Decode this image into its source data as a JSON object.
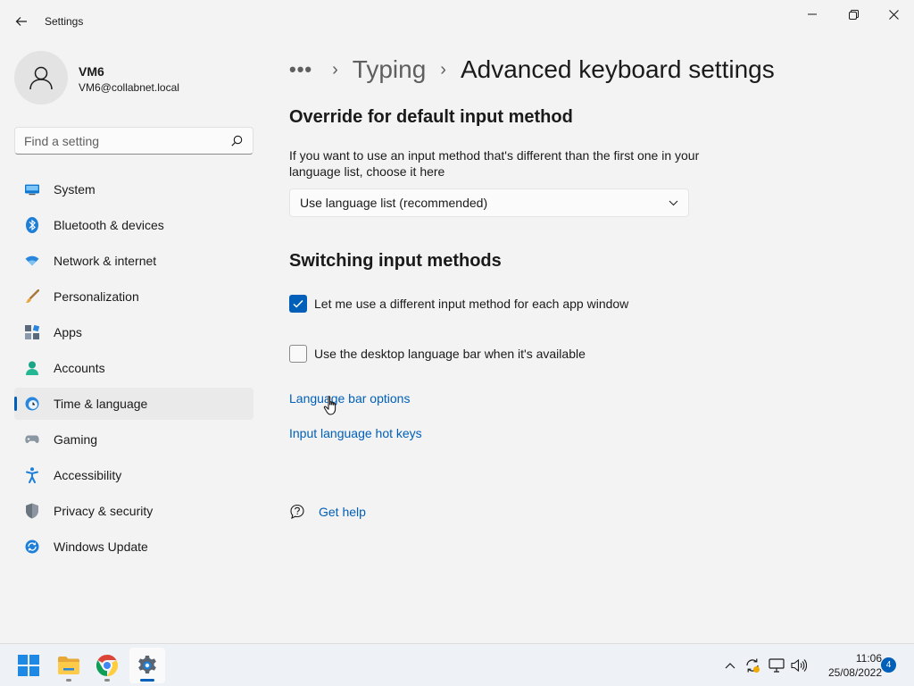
{
  "window": {
    "title": "Settings"
  },
  "profile": {
    "name": "VM6",
    "email": "VM6@collabnet.local"
  },
  "search": {
    "placeholder": "Find a setting"
  },
  "sidebar": {
    "items": [
      {
        "label": "System",
        "icon": "system-icon"
      },
      {
        "label": "Bluetooth & devices",
        "icon": "bluetooth-icon"
      },
      {
        "label": "Network & internet",
        "icon": "network-icon"
      },
      {
        "label": "Personalization",
        "icon": "personalization-icon"
      },
      {
        "label": "Apps",
        "icon": "apps-icon"
      },
      {
        "label": "Accounts",
        "icon": "accounts-icon"
      },
      {
        "label": "Time & language",
        "icon": "time-language-icon",
        "active": true
      },
      {
        "label": "Gaming",
        "icon": "gaming-icon"
      },
      {
        "label": "Accessibility",
        "icon": "accessibility-icon"
      },
      {
        "label": "Privacy & security",
        "icon": "privacy-icon"
      },
      {
        "label": "Windows Update",
        "icon": "windows-update-icon"
      }
    ]
  },
  "breadcrumb": {
    "more": "•••",
    "parent": "Typing",
    "current": "Advanced keyboard settings"
  },
  "override": {
    "heading": "Override for default input method",
    "description": "If you want to use an input method that's different than the first one in your language list, choose it here",
    "dropdown_value": "Use language list (recommended)"
  },
  "switching": {
    "heading": "Switching input methods",
    "option1_label": "Let me use a different input method for each app window",
    "option1_checked": true,
    "option2_label": "Use the desktop language bar when it's available",
    "option2_checked": false,
    "link1": "Language bar options",
    "link2": "Input language hot keys"
  },
  "help": {
    "label": "Get help"
  },
  "taskbar": {
    "time": "11:06",
    "date": "25/08/2022",
    "notification_count": "4"
  },
  "colors": {
    "accent": "#005fb8",
    "background": "#f3f3f3"
  }
}
